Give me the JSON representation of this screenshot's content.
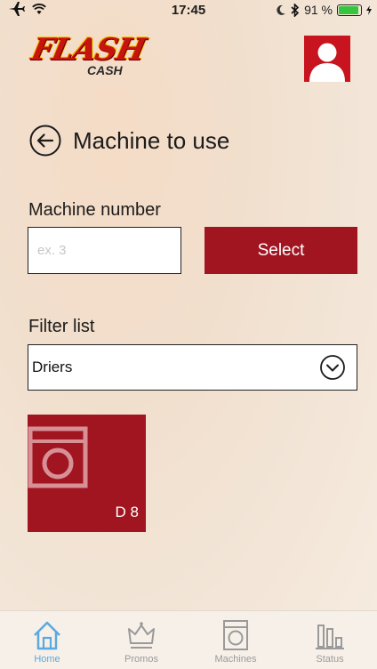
{
  "status_bar": {
    "time": "17:45",
    "battery_percent": "91 %",
    "battery_level": 0.91,
    "icons": [
      "airplane-icon",
      "wifi-icon",
      "moon-icon",
      "bluetooth-icon",
      "battery-icon",
      "charging-icon"
    ]
  },
  "header": {
    "logo_text": "FLASH",
    "logo_subtext": "CASH",
    "avatar_icon": "user-icon"
  },
  "page": {
    "title": "Machine to use",
    "back_icon": "arrow-left-circle-icon"
  },
  "machine_number": {
    "label": "Machine number",
    "placeholder": "ex. 3",
    "value": "",
    "select_label": "Select"
  },
  "filter": {
    "label": "Filter list",
    "selected": "Driers"
  },
  "machines": [
    {
      "label": "D 8",
      "icon": "washing-machine-icon"
    }
  ],
  "tabs": [
    {
      "label": "Home",
      "icon": "home-icon",
      "active": true
    },
    {
      "label": "Promos",
      "icon": "crown-icon",
      "active": false
    },
    {
      "label": "Machines",
      "icon": "washing-machine-icon",
      "active": false
    },
    {
      "label": "Status",
      "icon": "bar-chart-icon",
      "active": false
    }
  ],
  "colors": {
    "accent": "#a11521",
    "active_tab": "#5aa9e0",
    "inactive_tab": "#9a9a9a",
    "battery": "#36c53e"
  }
}
